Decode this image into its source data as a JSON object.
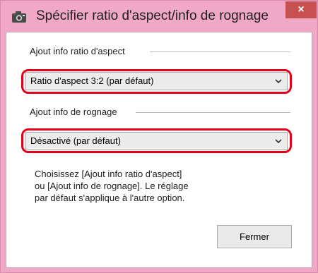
{
  "window": {
    "title": "Spécifier ratio d'aspect/info de rognage",
    "close_glyph": "×"
  },
  "aspect_group": {
    "label": "Ajout info ratio d'aspect",
    "selected": "Ratio d'aspect 3:2 (par défaut)"
  },
  "crop_group": {
    "label": "Ajout info de rognage",
    "selected": "Désactivé (par défaut)"
  },
  "info": {
    "lines": [
      "Choisissez [Ajout info ratio d'aspect]",
      "ou [Ajout info de rognage]. Le réglage",
      "par défaut s'applique à l'autre option."
    ]
  },
  "buttons": {
    "close_label": "Fermer"
  },
  "colors": {
    "titlebar": "#f0a8c6",
    "close_button": "#c75050",
    "highlight": "#e4001a"
  },
  "icons": {
    "app": "camera-icon",
    "dropdown": "chevron-down-icon"
  }
}
